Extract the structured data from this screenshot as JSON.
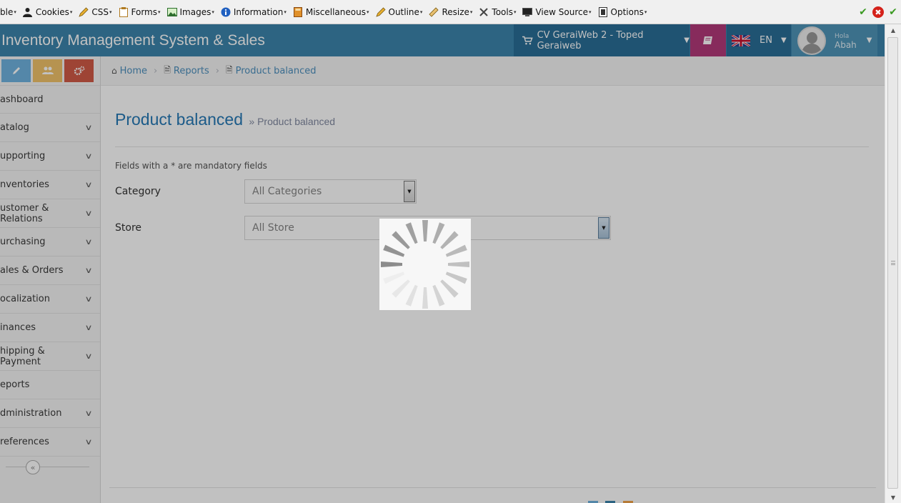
{
  "devbar": {
    "items": [
      {
        "label": "ble",
        "icon": "none"
      },
      {
        "label": "Cookies",
        "icon": "person-icon"
      },
      {
        "label": "CSS",
        "icon": "pencil-icon"
      },
      {
        "label": "Forms",
        "icon": "clipboard-icon"
      },
      {
        "label": "Images",
        "icon": "image-icon"
      },
      {
        "label": "Information",
        "icon": "info-icon"
      },
      {
        "label": "Miscellaneous",
        "icon": "book-icon"
      },
      {
        "label": "Outline",
        "icon": "pencil-icon"
      },
      {
        "label": "Resize",
        "icon": "ruler-icon"
      },
      {
        "label": "Tools",
        "icon": "tools-icon"
      },
      {
        "label": "View Source",
        "icon": "monitor-icon"
      },
      {
        "label": "Options",
        "icon": "options-icon"
      }
    ],
    "status_icons": [
      "check-icon",
      "error-icon",
      "check-icon"
    ]
  },
  "header": {
    "app_title": "Inventory Management System & Sales",
    "store_selector": "CV GeraiWeb 2 - Toped Geraiweb",
    "language": "EN",
    "greeting": "Hola",
    "user_name": "Abah"
  },
  "sidebar": {
    "items": [
      {
        "label": "ashboard",
        "has_children": false
      },
      {
        "label": "atalog",
        "has_children": true
      },
      {
        "label": "upporting",
        "has_children": true
      },
      {
        "label": "nventories",
        "has_children": true
      },
      {
        "label": "ustomer & Relations",
        "has_children": true
      },
      {
        "label": "urchasing",
        "has_children": true
      },
      {
        "label": "ales & Orders",
        "has_children": true
      },
      {
        "label": "ocalization",
        "has_children": true
      },
      {
        "label": "inances",
        "has_children": true
      },
      {
        "label": "hipping & Payment",
        "has_children": true
      },
      {
        "label": "eports",
        "has_children": false
      },
      {
        "label": "dministration",
        "has_children": true
      },
      {
        "label": "references",
        "has_children": true
      }
    ]
  },
  "breadcrumb": {
    "home": "Home",
    "reports": "Reports",
    "current": "Product balanced"
  },
  "page": {
    "title": "Product balanced",
    "subtitle": "» Product balanced",
    "mandatory_note": "Fields with a * are mandatory fields"
  },
  "form": {
    "category_label": "Category",
    "category_value": "All Categories",
    "store_label": "Store",
    "store_value": "All Store"
  },
  "colors": {
    "header": "#3c85ac",
    "header_dark": "#2a6e97",
    "book_button": "#b33a7a",
    "shortcut_blue": "#6fb3e0",
    "shortcut_orange": "#f1c36a",
    "shortcut_red": "#d15b47"
  }
}
